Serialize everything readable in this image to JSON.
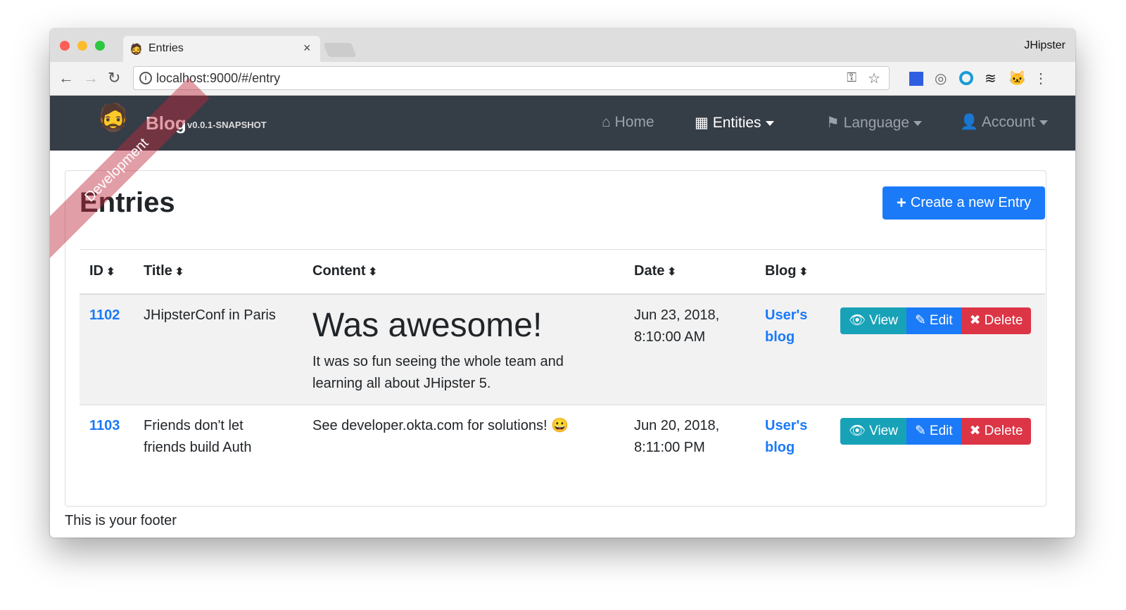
{
  "browser": {
    "tab_title": "Entries",
    "profile": "JHipster",
    "url": "localhost:9000/#/entry"
  },
  "navbar": {
    "brand": "Blog",
    "version": "v0.0.1-SNAPSHOT",
    "ribbon": "Development",
    "items": [
      {
        "label": "Home",
        "icon": "home-icon"
      },
      {
        "label": "Entities",
        "icon": "table-icon"
      },
      {
        "label": "Language",
        "icon": "flag-icon"
      },
      {
        "label": "Account",
        "icon": "user-icon"
      }
    ]
  },
  "page": {
    "title": "Entries",
    "create_label": "Create a new Entry"
  },
  "table": {
    "headers": [
      "ID",
      "Title",
      "Content",
      "Date",
      "Blog"
    ],
    "rows": [
      {
        "id": "1102",
        "title": "JHipsterConf in Paris",
        "content_heading": "Was awesome!",
        "content": "It was so fun seeing the whole team and learning all about JHipster 5.",
        "date": "Jun 23, 2018, 8:10:00 AM",
        "blog": "User's blog"
      },
      {
        "id": "1103",
        "title": "Friends don't let friends build Auth",
        "content_heading": "",
        "content": "See developer.okta.com for solutions! 😀",
        "date": "Jun 20, 2018, 8:11:00 PM",
        "blog": "User's blog"
      }
    ],
    "actions": {
      "view": "View",
      "edit": "Edit",
      "delete": "Delete"
    }
  },
  "footer": "This is your footer",
  "colors": {
    "navbar": "#353d47",
    "primary": "#1a7af8",
    "info": "#17a2b8",
    "danger": "#dc3545"
  }
}
